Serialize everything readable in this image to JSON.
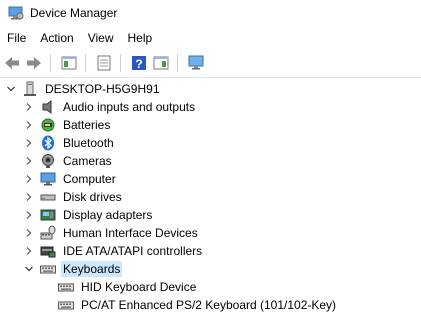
{
  "window": {
    "title": "Device Manager"
  },
  "menu": {
    "items": [
      "File",
      "Action",
      "View",
      "Help"
    ]
  },
  "tree": {
    "root": {
      "label": "DESKTOP-H5G9H91"
    },
    "categories": [
      {
        "label": "Audio inputs and outputs",
        "icon": "speaker-icon",
        "expanded": false
      },
      {
        "label": "Batteries",
        "icon": "battery-icon",
        "expanded": false
      },
      {
        "label": "Bluetooth",
        "icon": "bluetooth-icon",
        "expanded": false
      },
      {
        "label": "Cameras",
        "icon": "camera-icon",
        "expanded": false
      },
      {
        "label": "Computer",
        "icon": "monitor-icon",
        "expanded": false
      },
      {
        "label": "Disk drives",
        "icon": "disk-drive-icon",
        "expanded": false
      },
      {
        "label": "Display adapters",
        "icon": "display-adapter-icon",
        "expanded": false
      },
      {
        "label": "Human Interface Devices",
        "icon": "hid-icon",
        "expanded": false
      },
      {
        "label": "IDE ATA/ATAPI controllers",
        "icon": "ide-controller-icon",
        "expanded": false
      },
      {
        "label": "Keyboards",
        "icon": "keyboard-icon",
        "expanded": true,
        "selected": true
      }
    ],
    "keyboards_children": [
      {
        "label": "HID Keyboard Device",
        "icon": "keyboard-icon"
      },
      {
        "label": "PC/AT Enhanced PS/2 Keyboard (101/102-Key)",
        "icon": "keyboard-icon"
      }
    ]
  },
  "colors": {
    "selection": "#cce8ff",
    "bluetooth": "#1a6fd8",
    "help_icon": "#2b56c6"
  }
}
